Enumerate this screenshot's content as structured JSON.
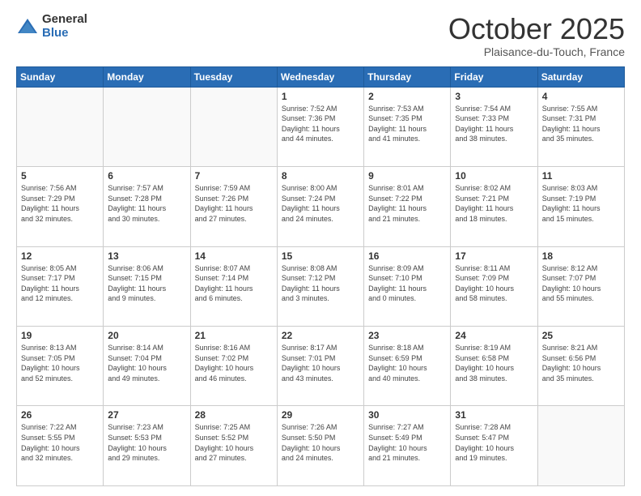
{
  "logo": {
    "general": "General",
    "blue": "Blue"
  },
  "header": {
    "month": "October 2025",
    "location": "Plaisance-du-Touch, France"
  },
  "days_of_week": [
    "Sunday",
    "Monday",
    "Tuesday",
    "Wednesday",
    "Thursday",
    "Friday",
    "Saturday"
  ],
  "weeks": [
    [
      {
        "day": "",
        "info": ""
      },
      {
        "day": "",
        "info": ""
      },
      {
        "day": "",
        "info": ""
      },
      {
        "day": "1",
        "info": "Sunrise: 7:52 AM\nSunset: 7:36 PM\nDaylight: 11 hours\nand 44 minutes."
      },
      {
        "day": "2",
        "info": "Sunrise: 7:53 AM\nSunset: 7:35 PM\nDaylight: 11 hours\nand 41 minutes."
      },
      {
        "day": "3",
        "info": "Sunrise: 7:54 AM\nSunset: 7:33 PM\nDaylight: 11 hours\nand 38 minutes."
      },
      {
        "day": "4",
        "info": "Sunrise: 7:55 AM\nSunset: 7:31 PM\nDaylight: 11 hours\nand 35 minutes."
      }
    ],
    [
      {
        "day": "5",
        "info": "Sunrise: 7:56 AM\nSunset: 7:29 PM\nDaylight: 11 hours\nand 32 minutes."
      },
      {
        "day": "6",
        "info": "Sunrise: 7:57 AM\nSunset: 7:28 PM\nDaylight: 11 hours\nand 30 minutes."
      },
      {
        "day": "7",
        "info": "Sunrise: 7:59 AM\nSunset: 7:26 PM\nDaylight: 11 hours\nand 27 minutes."
      },
      {
        "day": "8",
        "info": "Sunrise: 8:00 AM\nSunset: 7:24 PM\nDaylight: 11 hours\nand 24 minutes."
      },
      {
        "day": "9",
        "info": "Sunrise: 8:01 AM\nSunset: 7:22 PM\nDaylight: 11 hours\nand 21 minutes."
      },
      {
        "day": "10",
        "info": "Sunrise: 8:02 AM\nSunset: 7:21 PM\nDaylight: 11 hours\nand 18 minutes."
      },
      {
        "day": "11",
        "info": "Sunrise: 8:03 AM\nSunset: 7:19 PM\nDaylight: 11 hours\nand 15 minutes."
      }
    ],
    [
      {
        "day": "12",
        "info": "Sunrise: 8:05 AM\nSunset: 7:17 PM\nDaylight: 11 hours\nand 12 minutes."
      },
      {
        "day": "13",
        "info": "Sunrise: 8:06 AM\nSunset: 7:15 PM\nDaylight: 11 hours\nand 9 minutes."
      },
      {
        "day": "14",
        "info": "Sunrise: 8:07 AM\nSunset: 7:14 PM\nDaylight: 11 hours\nand 6 minutes."
      },
      {
        "day": "15",
        "info": "Sunrise: 8:08 AM\nSunset: 7:12 PM\nDaylight: 11 hours\nand 3 minutes."
      },
      {
        "day": "16",
        "info": "Sunrise: 8:09 AM\nSunset: 7:10 PM\nDaylight: 11 hours\nand 0 minutes."
      },
      {
        "day": "17",
        "info": "Sunrise: 8:11 AM\nSunset: 7:09 PM\nDaylight: 10 hours\nand 58 minutes."
      },
      {
        "day": "18",
        "info": "Sunrise: 8:12 AM\nSunset: 7:07 PM\nDaylight: 10 hours\nand 55 minutes."
      }
    ],
    [
      {
        "day": "19",
        "info": "Sunrise: 8:13 AM\nSunset: 7:05 PM\nDaylight: 10 hours\nand 52 minutes."
      },
      {
        "day": "20",
        "info": "Sunrise: 8:14 AM\nSunset: 7:04 PM\nDaylight: 10 hours\nand 49 minutes."
      },
      {
        "day": "21",
        "info": "Sunrise: 8:16 AM\nSunset: 7:02 PM\nDaylight: 10 hours\nand 46 minutes."
      },
      {
        "day": "22",
        "info": "Sunrise: 8:17 AM\nSunset: 7:01 PM\nDaylight: 10 hours\nand 43 minutes."
      },
      {
        "day": "23",
        "info": "Sunrise: 8:18 AM\nSunset: 6:59 PM\nDaylight: 10 hours\nand 40 minutes."
      },
      {
        "day": "24",
        "info": "Sunrise: 8:19 AM\nSunset: 6:58 PM\nDaylight: 10 hours\nand 38 minutes."
      },
      {
        "day": "25",
        "info": "Sunrise: 8:21 AM\nSunset: 6:56 PM\nDaylight: 10 hours\nand 35 minutes."
      }
    ],
    [
      {
        "day": "26",
        "info": "Sunrise: 7:22 AM\nSunset: 5:55 PM\nDaylight: 10 hours\nand 32 minutes."
      },
      {
        "day": "27",
        "info": "Sunrise: 7:23 AM\nSunset: 5:53 PM\nDaylight: 10 hours\nand 29 minutes."
      },
      {
        "day": "28",
        "info": "Sunrise: 7:25 AM\nSunset: 5:52 PM\nDaylight: 10 hours\nand 27 minutes."
      },
      {
        "day": "29",
        "info": "Sunrise: 7:26 AM\nSunset: 5:50 PM\nDaylight: 10 hours\nand 24 minutes."
      },
      {
        "day": "30",
        "info": "Sunrise: 7:27 AM\nSunset: 5:49 PM\nDaylight: 10 hours\nand 21 minutes."
      },
      {
        "day": "31",
        "info": "Sunrise: 7:28 AM\nSunset: 5:47 PM\nDaylight: 10 hours\nand 19 minutes."
      },
      {
        "day": "",
        "info": ""
      }
    ]
  ]
}
